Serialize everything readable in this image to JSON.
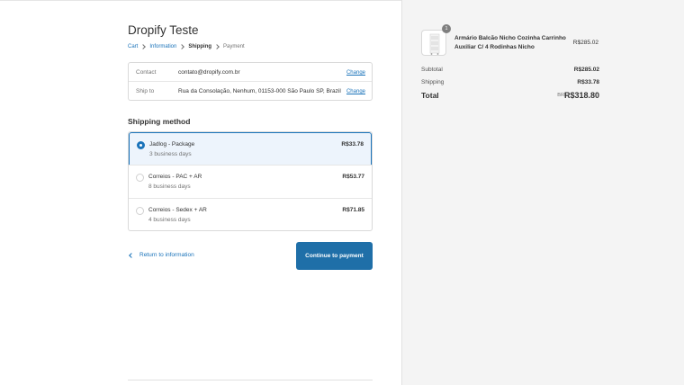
{
  "shop": {
    "name": "Dropify Teste"
  },
  "breadcrumb": {
    "cart": "Cart",
    "information": "Information",
    "shipping": "Shipping",
    "payment": "Payment"
  },
  "review": {
    "contact_label": "Contact",
    "contact_value": "contato@dropify.com.br",
    "ship_to_label": "Ship to",
    "ship_to_value": "Rua da Consolação, Nenhum, 01153-000 São Paulo SP, Brazil",
    "change_label": "Change"
  },
  "shipping_method": {
    "title": "Shipping method",
    "selected_index": 0,
    "options": [
      {
        "title": "Jadlog - Package",
        "subtitle": "3 business days",
        "price": "R$33.78"
      },
      {
        "title": "Correios - PAC + AR",
        "subtitle": "8 business days",
        "price": "R$53.77"
      },
      {
        "title": "Correios - Sedex + AR",
        "subtitle": "4 business days",
        "price": "R$71.85"
      }
    ]
  },
  "actions": {
    "return_label": "Return to information",
    "continue_label": "Continue to payment"
  },
  "order_summary": {
    "product": {
      "name": "Armário Balcão Nicho Cozinha Carrinho Auxiliar C/ 4 Rodinhas Nicho",
      "price": "R$285.02",
      "quantity": "1"
    },
    "subtotal_label": "Subtotal",
    "subtotal_value": "R$285.02",
    "shipping_label": "Shipping",
    "shipping_value": "R$33.78",
    "total_label": "Total",
    "currency": "BRL",
    "total_value": "R$318.80"
  },
  "colors": {
    "accent": "#1a73ba",
    "button": "#1f6fa8",
    "selected_bg": "#edf4fc",
    "sidebar_bg": "#f4f4f4"
  }
}
